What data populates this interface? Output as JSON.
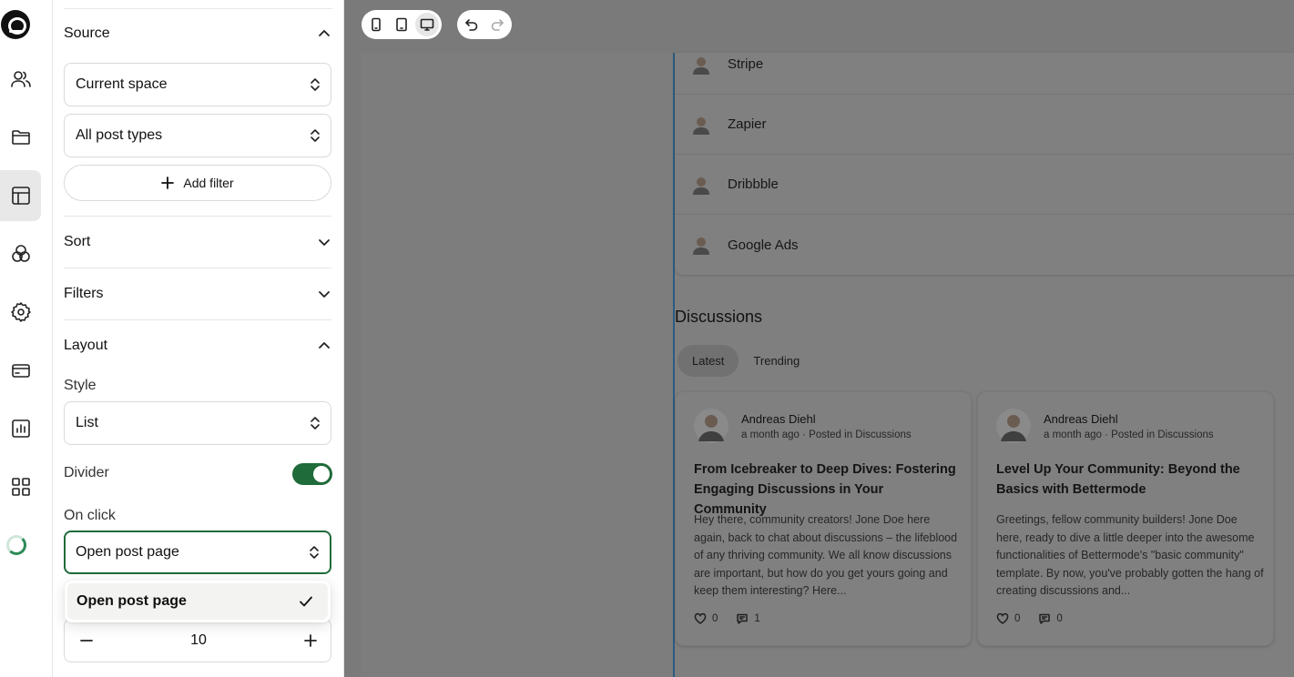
{
  "sidebar": {
    "source": {
      "title": "Source",
      "space_select": "Current space",
      "post_types_select": "All post types",
      "add_filter": "Add filter"
    },
    "sort": {
      "title": "Sort"
    },
    "filters": {
      "title": "Filters"
    },
    "layout": {
      "title": "Layout",
      "style_label": "Style",
      "style_value": "List",
      "divider_label": "Divider",
      "divider_on": true,
      "onclick_label": "On click",
      "onclick_value": "Open post page",
      "dropdown_options": [
        {
          "label": "Open post page",
          "selected": true
        }
      ],
      "count_value": "10"
    }
  },
  "colors": {
    "accent": "#1f6b3a",
    "canvas_overlay": "#7a7a7a"
  },
  "preview": {
    "list_items": [
      {
        "name": "Stripe"
      },
      {
        "name": "Zapier"
      },
      {
        "name": "Dribbble"
      },
      {
        "name": "Google Ads"
      }
    ],
    "discussions": {
      "title": "Discussions",
      "tabs": [
        {
          "label": "Latest",
          "active": true
        },
        {
          "label": "Trending",
          "active": false
        }
      ],
      "posts": [
        {
          "author": "Andreas Diehl",
          "meta": "a month ago · Posted in Discussions",
          "title": "From Icebreaker to Deep Dives: Fostering Engaging Discussions in Your Community",
          "excerpt": "Hey there, community creators! Jone Doe here again, back to chat about discussions – the lifeblood of any thriving community. We all know discussions are important, but how do you get yours going and keep them interesting? Here...",
          "likes": "0",
          "comments": "1"
        },
        {
          "author": "Andreas Diehl",
          "meta": "a month ago · Posted in Discussions",
          "title": "Level Up Your Community: Beyond the Basics with Bettermode",
          "excerpt": "Greetings, fellow community builders! Jone Doe here, ready to dive a little deeper into the awesome functionalities of Bettermode's \"basic community\" template. By now, you've probably gotten the hang of creating discussions and...",
          "likes": "0",
          "comments": "0"
        }
      ]
    }
  }
}
